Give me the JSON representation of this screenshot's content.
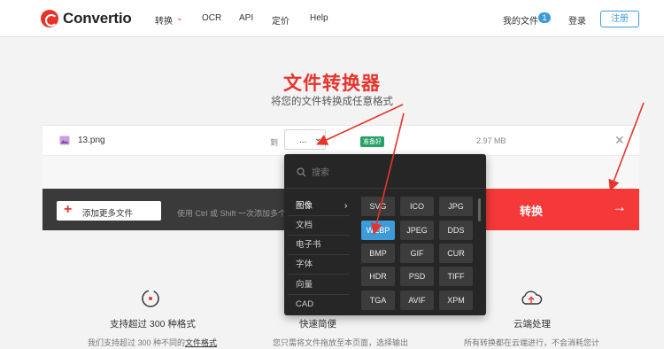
{
  "header": {
    "logo_text": "Convertio",
    "nav": [
      "转换",
      "OCR",
      "API",
      "定价",
      "Help"
    ],
    "my_files": "我的文件",
    "my_files_count": "1",
    "login": "登录",
    "signup": "注册"
  },
  "hero": {
    "title": "文件转换器",
    "subtitle": "将您的文件转换成任意格式"
  },
  "file": {
    "name": "13.png",
    "to_label": "到",
    "format_value": "...",
    "status": "准备好",
    "size": "2.97 MB"
  },
  "actions": {
    "add_more": "添加更多文件",
    "hint": "使用 Ctrl 或 Shift 一次添加多个文件",
    "convert": "转换"
  },
  "dropdown": {
    "search_placeholder": "搜索",
    "categories": [
      "图像",
      "文档",
      "电子书",
      "字体",
      "向量",
      "CAD"
    ],
    "formats": [
      "SVG",
      "ICO",
      "JPG",
      "WEBP",
      "JPEG",
      "DDS",
      "BMP",
      "GIF",
      "CUR",
      "HDR",
      "PSD",
      "TIFF",
      "TGA",
      "AVIF",
      "XPM"
    ],
    "selected_format": "WEBP"
  },
  "features": [
    {
      "title": "支持超过 300 种格式",
      "desc_prefix": "我们支持超过 300 种不同的",
      "desc_link": "文件格式"
    },
    {
      "title": "快速简便",
      "desc_prefix": "您只需将文件拖放至本页面，选择输出",
      "desc_link": ""
    },
    {
      "title": "云端处理",
      "desc_prefix": "所有转换都在云端进行，不会消耗您计",
      "desc_link": ""
    }
  ],
  "colors": {
    "brand_red": "#e8332b",
    "accent_blue": "#3d9bd9",
    "dropdown_bg": "#262626"
  }
}
